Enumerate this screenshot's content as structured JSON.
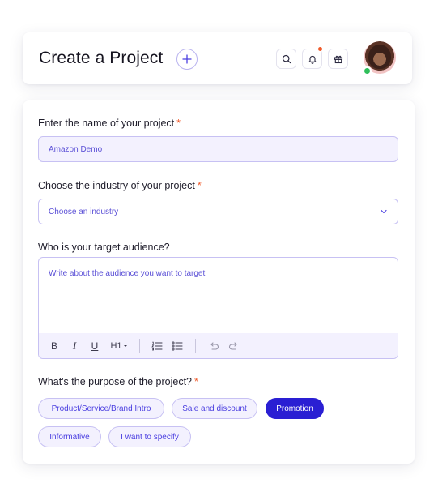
{
  "header": {
    "title": "Create a Project"
  },
  "form": {
    "name": {
      "label": "Enter the name of your project",
      "required_mark": "*",
      "value": "Amazon Demo"
    },
    "industry": {
      "label": "Choose the industry of your project",
      "required_mark": "*",
      "placeholder": "Choose an industry"
    },
    "audience": {
      "label": "Who is your target audience?",
      "placeholder": "Write about the audience you want to target",
      "toolbar": {
        "bold": "B",
        "italic": "I",
        "underline": "U",
        "heading": "H1"
      }
    },
    "purpose": {
      "label": "What's the purpose of the project?",
      "required_mark": "*",
      "options": [
        {
          "label": "Product/Service/Brand Intro",
          "selected": false
        },
        {
          "label": "Sale and discount",
          "selected": false
        },
        {
          "label": "Promotion",
          "selected": true
        },
        {
          "label": "Informative",
          "selected": false
        },
        {
          "label": "I want to specify",
          "selected": false
        }
      ]
    }
  },
  "colors": {
    "accent": "#2a1fd3",
    "required": "#f05a2a",
    "field_bg": "#f3f1fe",
    "field_border": "#c7c1f3",
    "online": "#2fbf5a"
  }
}
